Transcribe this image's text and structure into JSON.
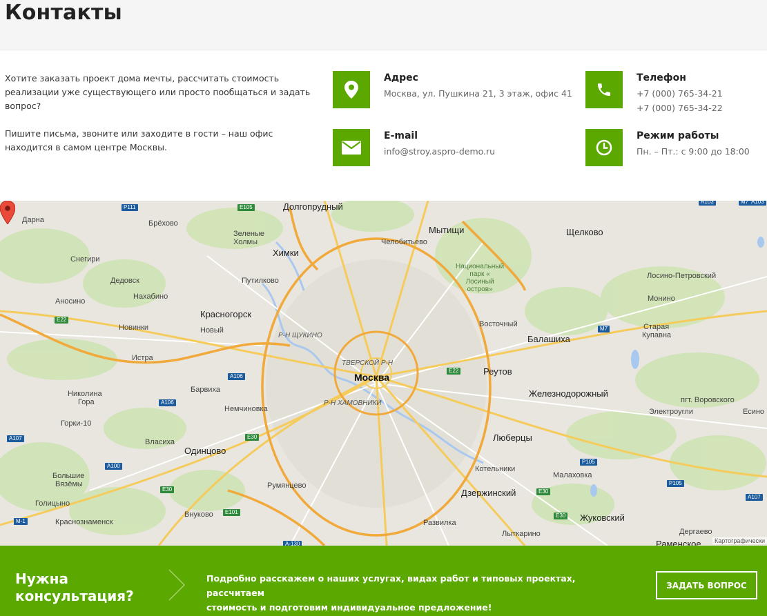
{
  "page": {
    "title": "Контакты"
  },
  "intro": {
    "paragraph1": "Хотите заказать проект дома мечты, рассчитать стоимость реализации уже существующего или просто пообщаться и задать вопрос?",
    "paragraph2": "Пишите письма, звоните или заходите в гости – наш офис находится в самом центре Москвы."
  },
  "contacts": {
    "address": {
      "title": "Адрес",
      "value": "Москва, ул. Пушкина 21, 3 этаж, офис 41",
      "icon": "map-pin-icon"
    },
    "phone": {
      "title": "Телефон",
      "value1": "+7 (000) 765-34-21",
      "value2": "+7 (000) 765-34-22",
      "icon": "phone-icon"
    },
    "email": {
      "title": "E-mail",
      "value": "info@stroy.aspro-demo.ru",
      "icon": "envelope-icon"
    },
    "hours": {
      "title": "Режим работы",
      "value": "Пн. – Пт.: с 9:00 до 18:00",
      "icon": "clock-icon"
    }
  },
  "map": {
    "center_label": "Москва",
    "attribution": "Картографически",
    "labels": [
      {
        "text": "Долгопрудный",
        "cls": "city"
      },
      {
        "text": "Мытищи",
        "cls": "city"
      },
      {
        "text": "Щелково",
        "cls": "city"
      },
      {
        "text": "Химки",
        "cls": "city"
      },
      {
        "text": "Дарна",
        "cls": "town"
      },
      {
        "text": "Брёхово",
        "cls": "town"
      },
      {
        "text": "Зеленые",
        "cls": "town"
      },
      {
        "text": "Холмы",
        "cls": "town"
      },
      {
        "text": "Челобитьево",
        "cls": "town"
      },
      {
        "text": "Снегири",
        "cls": "town"
      },
      {
        "text": "Дедовск",
        "cls": "town"
      },
      {
        "text": "Путилково",
        "cls": "town"
      },
      {
        "text": "Аносино",
        "cls": "town"
      },
      {
        "text": "Нахабино",
        "cls": "town"
      },
      {
        "text": "Лосино-Петровский",
        "cls": "town"
      },
      {
        "text": "Монино",
        "cls": "town"
      },
      {
        "text": "Красногорск",
        "cls": "city"
      },
      {
        "text": "Новинки",
        "cls": "town"
      },
      {
        "text": "Новый",
        "cls": "town"
      },
      {
        "text": "Р-Н ЩУКИНО",
        "cls": "district"
      },
      {
        "text": "Восточный",
        "cls": "town"
      },
      {
        "text": "Старая",
        "cls": "town"
      },
      {
        "text": "Купавна",
        "cls": "town"
      },
      {
        "text": "Балашиха",
        "cls": "city"
      },
      {
        "text": "Истра",
        "cls": "town"
      },
      {
        "text": "ТВЕРСКОЙ Р-Н",
        "cls": "district"
      },
      {
        "text": "Реутов",
        "cls": "city"
      },
      {
        "text": "Барвиха",
        "cls": "town"
      },
      {
        "text": "Николина",
        "cls": "town"
      },
      {
        "text": "Гора",
        "cls": "town"
      },
      {
        "text": "Р-Н ХАМОВНИКИ",
        "cls": "district"
      },
      {
        "text": "Железнодорожный",
        "cls": "city"
      },
      {
        "text": "Немчиновка",
        "cls": "town"
      },
      {
        "text": "пгт. Воровского",
        "cls": "town"
      },
      {
        "text": "Горки-10",
        "cls": "town"
      },
      {
        "text": "Электроугли",
        "cls": "town"
      },
      {
        "text": "Есино",
        "cls": "town"
      },
      {
        "text": "Власиха",
        "cls": "town"
      },
      {
        "text": "Люберцы",
        "cls": "city"
      },
      {
        "text": "Одинцово",
        "cls": "city"
      },
      {
        "text": "Котельники",
        "cls": "town"
      },
      {
        "text": "Малаховка",
        "cls": "town"
      },
      {
        "text": "Большие",
        "cls": "town"
      },
      {
        "text": "Вязёмы",
        "cls": "town"
      },
      {
        "text": "Румянцево",
        "cls": "town"
      },
      {
        "text": "Дзержинский",
        "cls": "city"
      },
      {
        "text": "Голицыно",
        "cls": "town"
      },
      {
        "text": "Внуково",
        "cls": "town"
      },
      {
        "text": "Жуковский",
        "cls": "city"
      },
      {
        "text": "Краснознаменск",
        "cls": "town"
      },
      {
        "text": "Развилка",
        "cls": "town"
      },
      {
        "text": "Лыткарино",
        "cls": "town"
      },
      {
        "text": "Дергаево",
        "cls": "town"
      },
      {
        "text": "Раменское",
        "cls": "city"
      }
    ],
    "park_label": [
      "Национальный",
      "парк «",
      "Лосиный",
      "остров»"
    ],
    "badges": [
      {
        "text": "Р111",
        "color": "blue"
      },
      {
        "text": "E105",
        "color": "green"
      },
      {
        "text": "A103",
        "color": "blue"
      },
      {
        "text": "A103",
        "color": "blue"
      },
      {
        "text": "E22",
        "color": "green"
      },
      {
        "text": "M7",
        "color": "blue"
      },
      {
        "text": "M7",
        "color": "blue"
      },
      {
        "text": "A106",
        "color": "blue"
      },
      {
        "text": "E22",
        "color": "green"
      },
      {
        "text": "A106",
        "color": "blue"
      },
      {
        "text": "A107",
        "color": "blue"
      },
      {
        "text": "E30",
        "color": "green"
      },
      {
        "text": "A100",
        "color": "blue"
      },
      {
        "text": "Р105",
        "color": "blue"
      },
      {
        "text": "Р105",
        "color": "blue"
      },
      {
        "text": "E30",
        "color": "green"
      },
      {
        "text": "E30",
        "color": "green"
      },
      {
        "text": "A107",
        "color": "blue"
      },
      {
        "text": "E101",
        "color": "green"
      },
      {
        "text": "E30",
        "color": "green"
      },
      {
        "text": "M-1",
        "color": "blue"
      },
      {
        "text": "A-130",
        "color": "blue"
      }
    ]
  },
  "cta": {
    "title_line1": "Нужна",
    "title_line2": "консультация?",
    "text_line1": "Подробно расскажем о наших услугах, видах работ и типовых проектах, рассчитаем",
    "text_line2": "стоимость и подготовим индивидуальное предложение!",
    "button_label": "ЗАДАТЬ ВОПРОС"
  },
  "colors": {
    "accent": "#5aa800"
  }
}
